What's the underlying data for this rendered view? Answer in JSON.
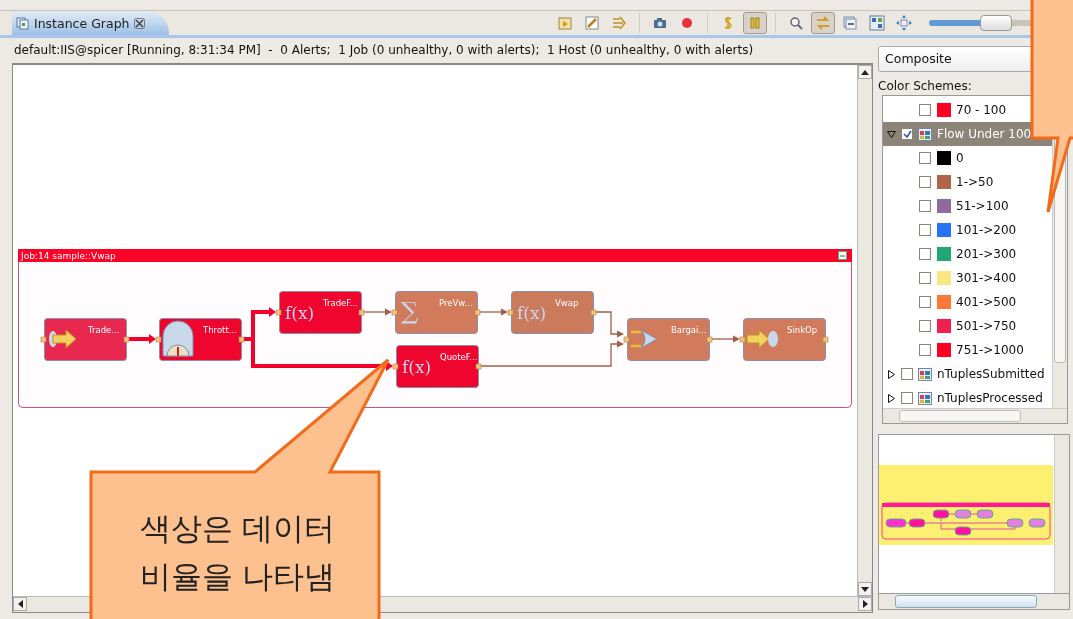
{
  "view_tab": {
    "label": "Instance Graph",
    "selected": true
  },
  "toolbar": [
    {
      "kind": "open",
      "pressed": false
    },
    {
      "kind": "edit",
      "pressed": false
    },
    {
      "kind": "route",
      "pressed": false
    },
    {
      "kind": "camera",
      "pressed": false
    },
    {
      "kind": "record",
      "pressed": false
    },
    {
      "kind": "dollar",
      "pressed": false
    },
    {
      "kind": "pause",
      "pressed": true
    },
    {
      "kind": "search",
      "pressed": false
    },
    {
      "kind": "swap",
      "pressed": true
    },
    {
      "kind": "collapse",
      "pressed": false
    },
    {
      "kind": "layout",
      "pressed": false
    },
    {
      "kind": "fit",
      "pressed": false
    }
  ],
  "zoom_slider": {
    "level": 0.48
  },
  "status": "default:IIS@spicer [Running, 8:31:34 PM]  -  0 Alerts;  1 Job (0 unhealthy, 0 with alerts);  1 Host (0 unhealthy, 0 with alerts)",
  "job": {
    "title": "Job:14  sample::Vwap"
  },
  "nodes": [
    {
      "label": "Trade...",
      "kind": "source",
      "color": "#e8284e"
    },
    {
      "label": "Thrott...",
      "kind": "throttle",
      "color": "#f0052e"
    },
    {
      "label": "TradeF...",
      "kind": "function",
      "symbol": "f(x)",
      "color": "#f0052e"
    },
    {
      "label": "PreVw...",
      "kind": "aggregate",
      "symbol": "∑",
      "color": "#d27a5c"
    },
    {
      "label": "Vwap",
      "kind": "function",
      "symbol": "f(x)",
      "color": "#cc7a5c"
    },
    {
      "label": "QuoteF...",
      "kind": "function",
      "symbol": "f(x)",
      "color": "#f0052e"
    },
    {
      "label": "Bargai...",
      "kind": "join",
      "color": "#d27a5c"
    },
    {
      "label": "SinkOp",
      "kind": "sink",
      "color": "#d27a5c"
    }
  ],
  "edges": [
    {
      "heavy": true
    },
    {
      "heavy": true
    },
    {
      "heavy": true
    },
    {
      "heavy": false
    },
    {
      "heavy": false
    },
    {
      "heavy": false
    },
    {
      "heavy": false
    },
    {
      "heavy": false
    }
  ],
  "scheme_select": {
    "value": "Composite"
  },
  "schemes_label": "Color Schemes:",
  "schemes": [
    {
      "children": [
        {
          "label": "70 - 100",
          "color": "#ff0022",
          "checked": false
        }
      ]
    },
    {
      "label": "Flow Under 100",
      "expanded": true,
      "checked": true,
      "selected": true,
      "children": [
        {
          "label": "0",
          "color": "#000000",
          "checked": false
        },
        {
          "label": "1->50",
          "color": "#b0654a",
          "checked": false
        },
        {
          "label": "51->100",
          "color": "#9069a0",
          "checked": false
        },
        {
          "label": "101->200",
          "color": "#2673f5",
          "checked": false
        },
        {
          "label": "201->300",
          "color": "#1ea874",
          "checked": false
        },
        {
          "label": "301->400",
          "color": "#fce681",
          "checked": false
        },
        {
          "label": "401->500",
          "color": "#fc7a38",
          "checked": false
        },
        {
          "label": "501->750",
          "color": "#ee2050",
          "checked": false
        },
        {
          "label": "751->1000",
          "color": "#ff0022",
          "checked": false
        }
      ]
    },
    {
      "label": "nTuplesSubmitted",
      "expanded": false,
      "checked": false,
      "selected": false
    },
    {
      "label": "nTuplesProcessed",
      "expanded": false,
      "checked": false,
      "selected": false
    }
  ],
  "callouts": [
    {
      "text": "색상은 데이터\n비율을 나타냄"
    }
  ]
}
